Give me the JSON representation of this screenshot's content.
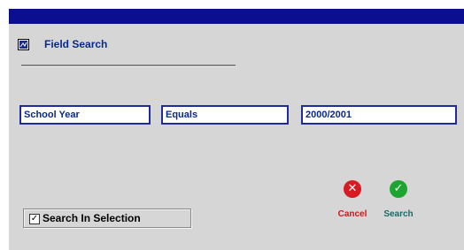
{
  "window": {
    "title_bar_color": "#0b0f8f"
  },
  "header": {
    "title": "Field Search",
    "icon": "field-search-icon"
  },
  "criteria": {
    "field": "School Year",
    "operator": "Equals",
    "value": "2000/2001"
  },
  "options": {
    "search_in_selection_label": "Search In Selection",
    "search_in_selection_checked": true,
    "check_glyph": "✓"
  },
  "actions": {
    "cancel_label": "Cancel",
    "cancel_icon": "x-icon",
    "cancel_glyph": "✕",
    "search_label": "Search",
    "search_icon": "checkmark-icon",
    "search_glyph": "✓"
  }
}
